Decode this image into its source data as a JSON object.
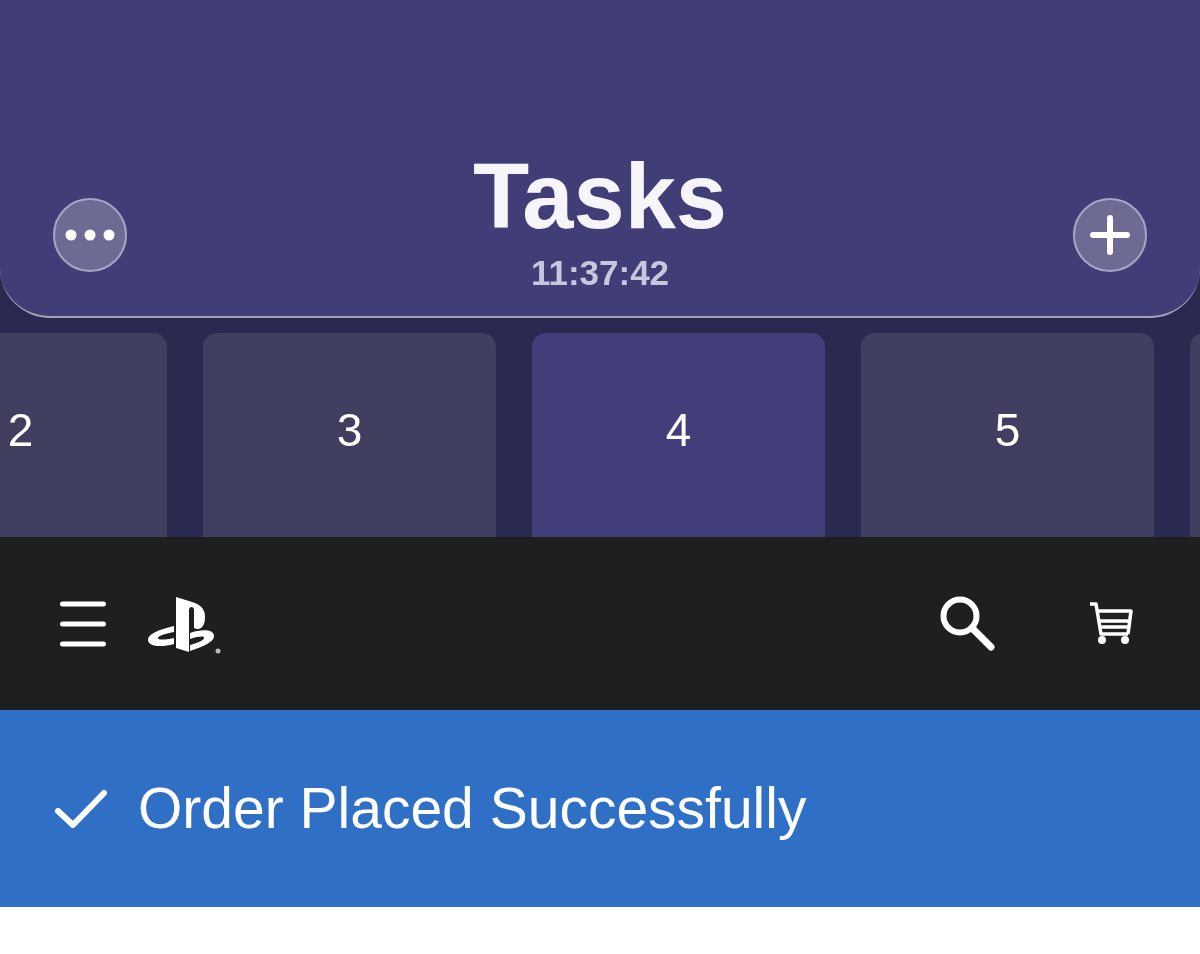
{
  "header": {
    "title": "Tasks",
    "time": "11:37:42"
  },
  "tabs": [
    {
      "label": "2",
      "selected": false
    },
    {
      "label": "3",
      "selected": false
    },
    {
      "label": "4",
      "selected": true
    },
    {
      "label": "5",
      "selected": false
    },
    {
      "selected": false
    }
  ],
  "banner": {
    "message": "Order Placed Successfully"
  }
}
